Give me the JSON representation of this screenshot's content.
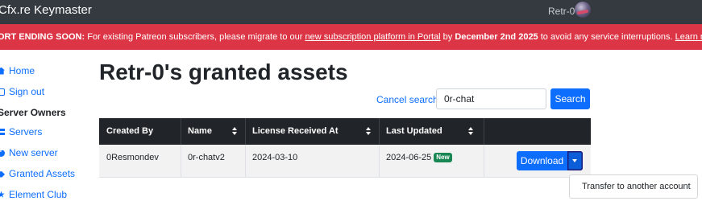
{
  "navbar": {
    "brand": "Cfx.re Keymaster",
    "user_name": "Retr-0"
  },
  "alert": {
    "prefix": "ORT ENDING SOON:",
    "text1": " For existing Patreon subscribers, please migrate to our ",
    "link1": "new subscription platform in Portal",
    "text2": " by ",
    "date": "December 2nd 2025",
    "text3": " to avoid any service interruptions. ",
    "link2": "Learn more",
    "text4": "."
  },
  "sidebar": {
    "home": "Home",
    "sign_out": "Sign out",
    "section_heading": "Server Owners",
    "servers": "Servers",
    "new_server": "New server",
    "granted_assets": "Granted Assets",
    "element_club": "Element Club"
  },
  "main": {
    "title": "Retr-0's granted assets",
    "cancel_search": "Cancel search",
    "search_value": "0r-chat",
    "search_button": "Search"
  },
  "table": {
    "columns": [
      "Created By",
      "Name",
      "License Received At",
      "Last Updated"
    ],
    "rows": [
      {
        "created_by": "0Resmondev",
        "name": "0r-chatv2",
        "license_received_at": "2024-03-10",
        "last_updated": "2024-06-25",
        "badge": "New",
        "action": "Download"
      }
    ]
  },
  "dropdown": {
    "items": [
      "Transfer to another account"
    ]
  },
  "colors": {
    "navbar_bg": "#343a40",
    "alert_bg": "#dc3545",
    "primary": "#0d6efd",
    "table_head_bg": "#212529",
    "badge_new": "#198754"
  }
}
